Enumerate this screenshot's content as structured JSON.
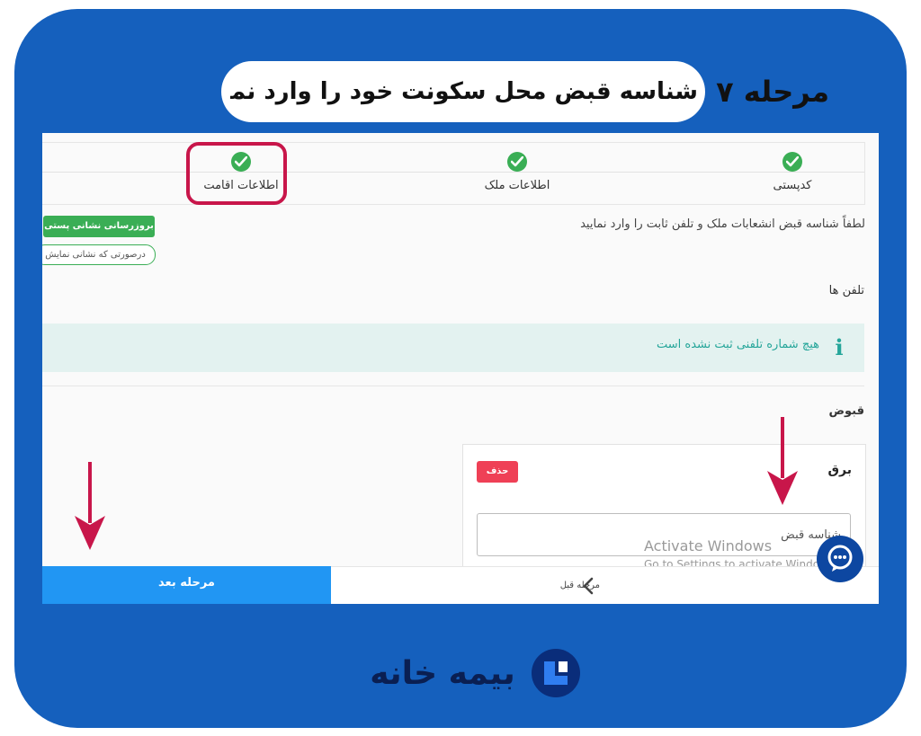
{
  "header": {
    "step_label": "مرحله ۷",
    "title": "شناسه قبض محل سکونت خود را وارد نمایید"
  },
  "stepper": {
    "steps": [
      {
        "label": "کدپستی"
      },
      {
        "label": "اطلاعات ملک"
      },
      {
        "label": "اطلاعات اقامت"
      }
    ]
  },
  "form": {
    "instruction": "لطفاً شناسه قبض انشعابات ملک و تلفن ثابت را وارد نمایید",
    "update_postal_button": "بروزرسانی نشانی پستی",
    "postal_hint": "درصورتی که نشانی نمایش",
    "phones_title": "تلفن ها",
    "no_phone_message": "هیچ شماره تلفنی ثبت نشده است",
    "receipts_title": "قبوض",
    "receipt_card": {
      "title": "برق",
      "delete_button": "حذف",
      "input_placeholder": "شناسه قبض"
    }
  },
  "footer": {
    "next_button": "مرحله بعد",
    "prev_button": "مرحله قبل"
  },
  "watermark": {
    "line1": "Activate Windows",
    "line2": "Go to Settings to activate Windows."
  },
  "brand": {
    "logo_text": "بیمه خانه"
  },
  "colors": {
    "frame_blue": "#1560bd",
    "success_green": "#3aae55",
    "highlight_red": "#c8164a",
    "next_blue": "#2196f3",
    "delete_red": "#ef4056",
    "info_teal": "#26a69a"
  },
  "icons": [
    "check-icon",
    "info-icon",
    "chevron-left-icon",
    "chat-icon",
    "down-arrow-icon",
    "logo-icon"
  ]
}
